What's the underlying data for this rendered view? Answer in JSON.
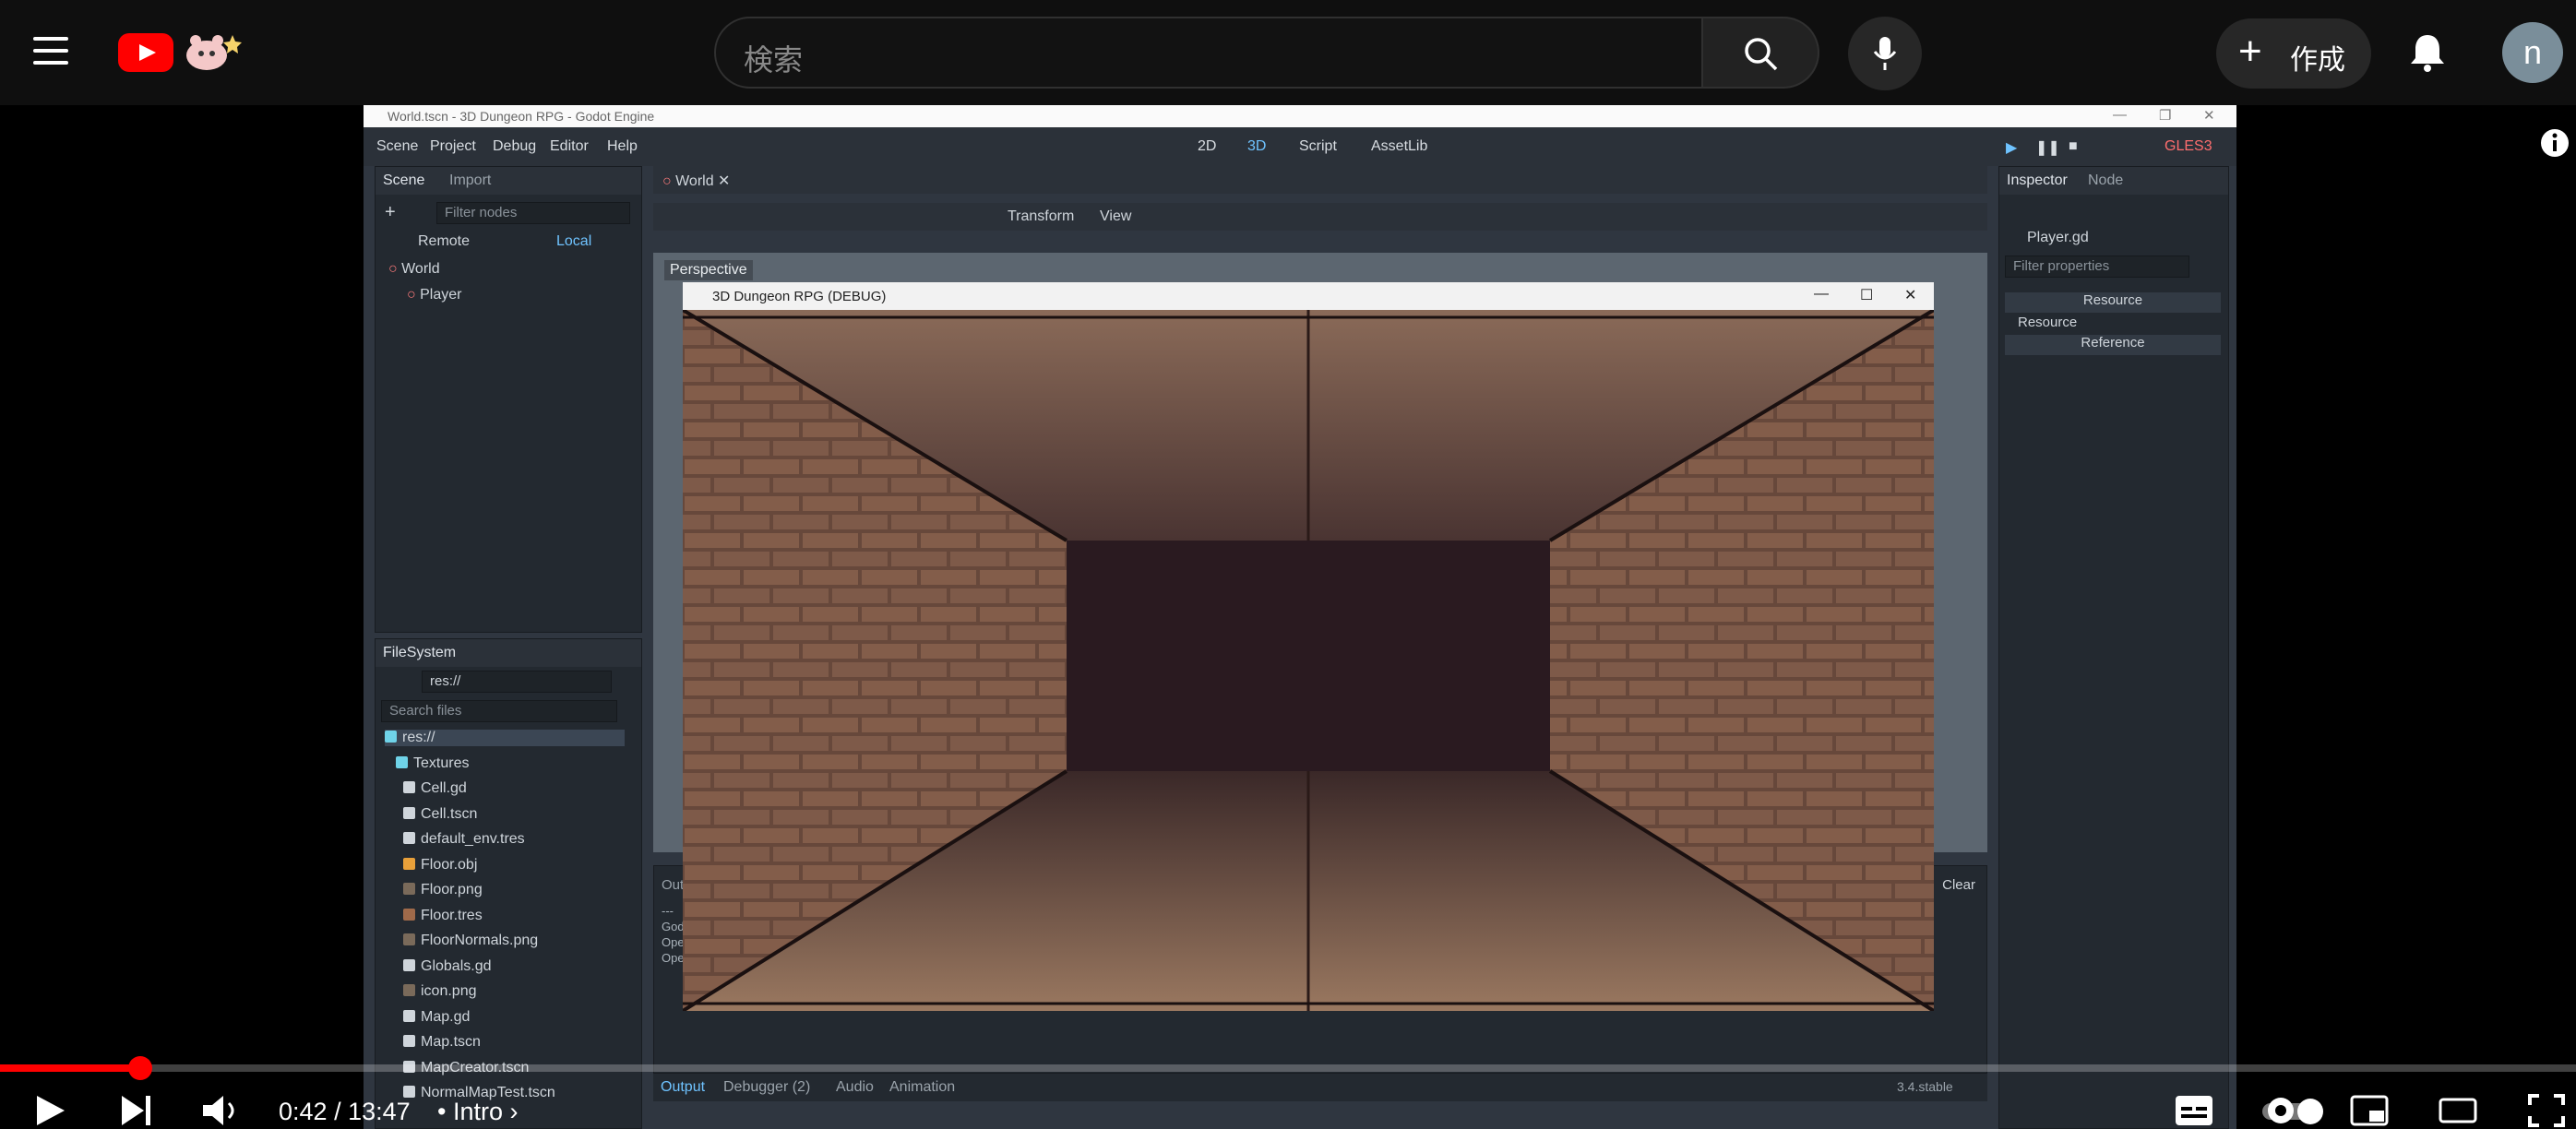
{
  "youtube": {
    "search_placeholder": "検索",
    "create_label": "作成",
    "avatar_letter": "n",
    "time_current": "0:42",
    "time_separator": " / ",
    "time_total": "13:47",
    "chapter_bullet": "•",
    "chapter": "Intro",
    "progress_fraction": 0.052,
    "brand_color": "#ff0000"
  },
  "godot": {
    "window_title": "World.tscn - 3D Dungeon RPG - Godot Engine",
    "menu": [
      "Scene",
      "Project",
      "Debug",
      "Editor",
      "Help"
    ],
    "workspaces": [
      "2D",
      "3D",
      "Script",
      "AssetLib"
    ],
    "renderer": "GLES3",
    "scene_tabs": [
      "Scene",
      "Import"
    ],
    "filter_nodes_placeholder": "Filter nodes",
    "remote_label": "Remote",
    "local_label": "Local",
    "scene_tree": [
      "World",
      "Player"
    ],
    "filesystem_title": "FileSystem",
    "fs_path": "res://",
    "search_files_placeholder": "Search files",
    "files": [
      {
        "name": "res://",
        "icon": "folder"
      },
      {
        "name": "Textures",
        "icon": "folder"
      },
      {
        "name": "Cell.gd",
        "icon": "gear"
      },
      {
        "name": "Cell.tscn",
        "icon": "scene"
      },
      {
        "name": "default_env.tres",
        "icon": "env"
      },
      {
        "name": "Floor.obj",
        "icon": "mesh"
      },
      {
        "name": "Floor.png",
        "icon": "image"
      },
      {
        "name": "Floor.tres",
        "icon": "material"
      },
      {
        "name": "FloorNormals.png",
        "icon": "image"
      },
      {
        "name": "Globals.gd",
        "icon": "gear"
      },
      {
        "name": "icon.png",
        "icon": "image"
      },
      {
        "name": "Map.gd",
        "icon": "gear"
      },
      {
        "name": "Map.tscn",
        "icon": "scene"
      },
      {
        "name": "MapCreator.tscn",
        "icon": "scene"
      },
      {
        "name": "NormalMapTest.tscn",
        "icon": "scene"
      }
    ],
    "editor_tab": "World",
    "toolbar_menus": [
      "Transform",
      "View"
    ],
    "perspective_label": "Perspective",
    "output_label_partial": "Out",
    "clear_label": "Clear",
    "output_lines": [
      "---",
      "God",
      "Ope",
      "Ope"
    ],
    "bottom_tabs": [
      "Output",
      "Debugger (2)",
      "Audio",
      "Animation"
    ],
    "version": "3.4.stable",
    "inspector_tabs": [
      "Inspector",
      "Node"
    ],
    "inspected_object": "Player.gd",
    "filter_properties_placeholder": "Filter properties",
    "inspector_items": [
      "Resource",
      "Resource",
      "Reference"
    ],
    "game_window_title": "3D Dungeon RPG (DEBUG)"
  }
}
